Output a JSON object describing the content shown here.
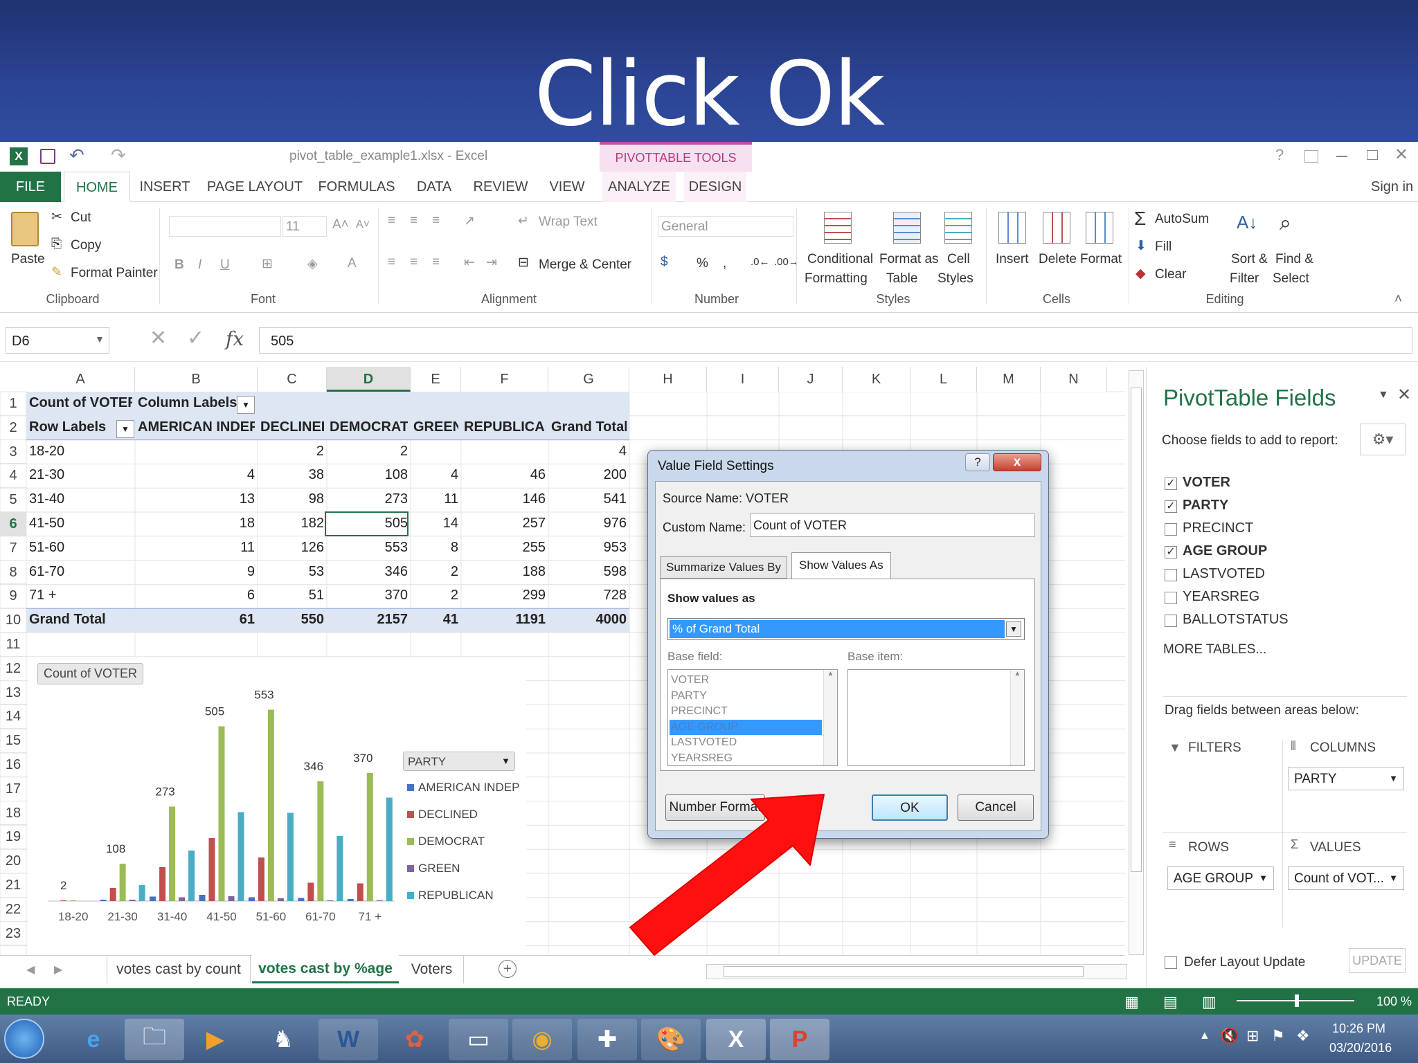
{
  "banner": {
    "title": "Click Ok"
  },
  "window": {
    "title": "pivot_table_example1.xlsx - Excel",
    "context_tab_group": "PIVOTTABLE TOOLS",
    "sign_in": "Sign in"
  },
  "ribbon_tabs": [
    "FILE",
    "HOME",
    "INSERT",
    "PAGE LAYOUT",
    "FORMULAS",
    "DATA",
    "REVIEW",
    "VIEW",
    "ANALYZE",
    "DESIGN"
  ],
  "ribbon": {
    "clipboard": {
      "paste": "Paste",
      "cut": "Cut",
      "copy": "Copy",
      "format_painter": "Format Painter",
      "label": "Clipboard"
    },
    "font": {
      "size": "11",
      "label": "Font",
      "bold": "B",
      "italic": "I",
      "underline": "U"
    },
    "alignment": {
      "wrap_text": "Wrap Text",
      "merge_center": "Merge & Center",
      "label": "Alignment"
    },
    "number": {
      "format": "General",
      "percent": "%",
      "comma": ",",
      "label": "Number"
    },
    "styles": {
      "conditional": "Conditional",
      "formatting": "Formatting",
      "format_as": "Format as",
      "table": "Table",
      "cell": "Cell",
      "styles": "Styles",
      "label": "Styles"
    },
    "cells": {
      "insert": "Insert",
      "delete": "Delete",
      "format": "Format",
      "label": "Cells"
    },
    "editing": {
      "autosum": "AutoSum",
      "fill": "Fill",
      "clear": "Clear",
      "sort": "Sort &",
      "filter": "Filter",
      "find": "Find &",
      "select": "Select",
      "label": "Editing"
    }
  },
  "formula_bar": {
    "name_box": "D6",
    "fx": "fx",
    "value": "505"
  },
  "columns": [
    "A",
    "B",
    "C",
    "D",
    "E",
    "F",
    "G",
    "H",
    "I",
    "J",
    "K",
    "L",
    "M",
    "N"
  ],
  "rows": [
    "1",
    "2",
    "3",
    "4",
    "5",
    "6",
    "7",
    "8",
    "9",
    "10",
    "11",
    "12",
    "13",
    "14",
    "15",
    "16",
    "17",
    "18",
    "19",
    "20",
    "21",
    "22",
    "23"
  ],
  "pivot": {
    "r1": {
      "a": "Count of VOTER",
      "b": "Column Labels"
    },
    "headers": [
      "Row Labels",
      "AMERICAN INDEP",
      "DECLINED",
      "DEMOCRAT",
      "GREEN",
      "REPUBLICAN",
      "Grand Total"
    ],
    "data": [
      [
        "18-20",
        "",
        "2",
        "2",
        "",
        "",
        "4"
      ],
      [
        "21-30",
        "4",
        "38",
        "108",
        "4",
        "46",
        "200"
      ],
      [
        "31-40",
        "13",
        "98",
        "273",
        "11",
        "146",
        "541"
      ],
      [
        "41-50",
        "18",
        "182",
        "505",
        "14",
        "257",
        "976"
      ],
      [
        "51-60",
        "11",
        "126",
        "553",
        "8",
        "255",
        "953"
      ],
      [
        "61-70",
        "9",
        "53",
        "346",
        "2",
        "188",
        "598"
      ],
      [
        "71 +",
        "6",
        "51",
        "370",
        "2",
        "299",
        "728"
      ]
    ],
    "total": [
      "Grand Total",
      "61",
      "550",
      "2157",
      "41",
      "1191",
      "4000"
    ]
  },
  "chart_data": {
    "type": "bar",
    "title": "Count of VOTER",
    "categories": [
      "18-20",
      "21-30",
      "31-40",
      "41-50",
      "51-60",
      "61-70",
      "71 +"
    ],
    "series": [
      {
        "name": "AMERICAN INDEP",
        "values": [
          0,
          4,
          13,
          18,
          11,
          9,
          6
        ],
        "color": "#4472c4"
      },
      {
        "name": "DECLINED",
        "values": [
          2,
          38,
          98,
          182,
          126,
          53,
          51
        ],
        "color": "#c0504d"
      },
      {
        "name": "DEMOCRAT",
        "values": [
          2,
          108,
          273,
          505,
          553,
          346,
          370
        ],
        "color": "#9bbb59"
      },
      {
        "name": "GREEN",
        "values": [
          0,
          4,
          11,
          14,
          8,
          2,
          2
        ],
        "color": "#8064a2"
      },
      {
        "name": "REPUBLICAN",
        "values": [
          0,
          46,
          146,
          257,
          255,
          188,
          299
        ],
        "color": "#4bacc6"
      }
    ],
    "data_labels": [
      "2",
      "108",
      "273",
      "505",
      "553",
      "346",
      "370"
    ],
    "ylim": [
      0,
      600
    ],
    "legend_title": "PARTY",
    "legend_position": "right"
  },
  "sheet_tabs": [
    "votes cast by count",
    "votes cast by %age",
    "Voters"
  ],
  "status": {
    "ready": "READY",
    "zoom": "100 %"
  },
  "dialog": {
    "title": "Value Field Settings",
    "help": "?",
    "close": "x",
    "source_label": "Source Name:",
    "source_value": "VOTER",
    "custom_label": "Custom Name:",
    "custom_value": "Count of VOTER",
    "tabs": [
      "Summarize Values By",
      "Show Values As"
    ],
    "show_values_label": "Show values as",
    "show_values_selected": "% of Grand Total",
    "base_field_label": "Base field:",
    "base_item_label": "Base item:",
    "base_fields": [
      "VOTER",
      "PARTY",
      "PRECINCT",
      "AGE GROUP",
      "LASTVOTED",
      "YEARSREG"
    ],
    "number_format": "Number Format",
    "ok": "OK",
    "cancel": "Cancel"
  },
  "pivot_pane": {
    "title": "PivotTable Fields",
    "choose": "Choose fields to add to report:",
    "fields": [
      {
        "name": "VOTER",
        "checked": true
      },
      {
        "name": "PARTY",
        "checked": true
      },
      {
        "name": "PRECINCT",
        "checked": false
      },
      {
        "name": "AGE GROUP",
        "checked": true
      },
      {
        "name": "LASTVOTED",
        "checked": false
      },
      {
        "name": "YEARSREG",
        "checked": false
      },
      {
        "name": "BALLOTSTATUS",
        "checked": false
      }
    ],
    "more_tables": "MORE TABLES...",
    "drag_hint": "Drag fields between areas below:",
    "filters": "FILTERS",
    "columns": "COLUMNS",
    "columns_item": "PARTY",
    "rows": "ROWS",
    "rows_item": "AGE GROUP",
    "values": "VALUES",
    "values_item": "Count of VOT...",
    "defer": "Defer Layout Update",
    "update": "UPDATE"
  },
  "taskbar": {
    "time": "10:26 PM",
    "date": "03/20/2016"
  }
}
